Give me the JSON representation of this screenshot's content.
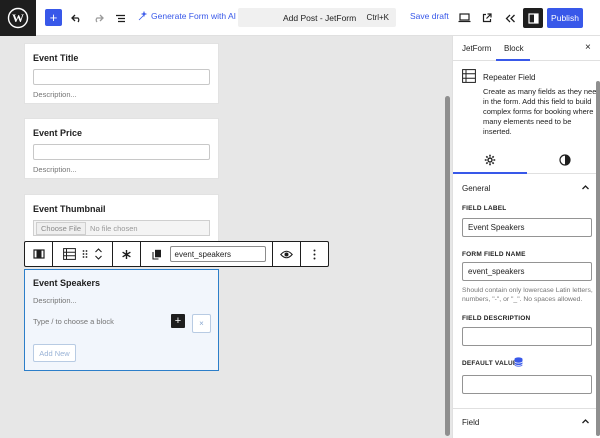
{
  "topbar": {
    "generate_form_label": "Generate Form with AI",
    "document_title": "Add Post - JetForm",
    "shortcut": "Ctrl+K",
    "save_draft_label": "Save draft",
    "publish_label": "Publish",
    "accent_color": "#3858e9"
  },
  "canvas": {
    "fields": [
      {
        "title": "Event Title",
        "description": "Description..."
      },
      {
        "title": "Event Price",
        "description": "Description..."
      },
      {
        "title": "Event Thumbnail",
        "file_button": "Choose File",
        "file_status": "No file chosen"
      }
    ],
    "toolbar": {
      "field_name_value": "event_speakers"
    },
    "repeater": {
      "title": "Event Speakers",
      "description": "Description...",
      "placeholder": "Type / to choose a block",
      "plus_label": "+",
      "remove_label": "×",
      "add_new_label": "Add New"
    }
  },
  "sidebar": {
    "tabs": [
      "JetForm",
      "Block"
    ],
    "active_tab": "Block",
    "close_label": "×",
    "block": {
      "name": "Repeater Field",
      "description": "Create as many fields as they need in the form. Add this field to build complex forms for booking where many elements need to be inserted."
    },
    "general": {
      "heading": "General",
      "field_label_caption": "FIELD LABEL",
      "field_label_value": "Event Speakers",
      "form_field_name_caption": "FORM FIELD NAME",
      "form_field_name_value": "event_speakers",
      "form_field_name_help": "Should contain only lowercase Latin letters, numbers, \"-\", or \"_\". No spaces allowed.",
      "field_description_caption": "FIELD DESCRIPTION",
      "field_description_value": "",
      "default_value_caption": "DEFAULT VALUE",
      "default_value_value": ""
    },
    "field_panel": {
      "heading": "Field"
    },
    "icons": [
      "gear-icon",
      "half-circle-icon",
      "database-icon",
      "chevron-up-icon"
    ]
  }
}
